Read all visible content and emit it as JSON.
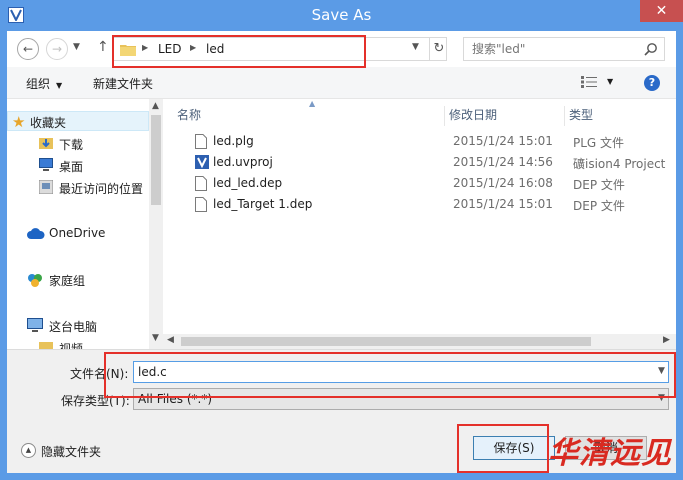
{
  "window": {
    "title": "Save As",
    "close_glyph": "✕"
  },
  "address": {
    "breadcrumbs": [
      "LED",
      "led"
    ],
    "search_placeholder": "搜索\"led\""
  },
  "toolbar": {
    "organize_label": "组织",
    "new_folder_label": "新建文件夹",
    "help_glyph": "?"
  },
  "nav": {
    "items": [
      {
        "label": "收藏夹",
        "icon": "star-icon"
      },
      {
        "label": "下载",
        "icon": "download-folder-icon"
      },
      {
        "label": "桌面",
        "icon": "desktop-icon"
      },
      {
        "label": "最近访问的位置",
        "icon": "recent-places-icon"
      },
      {
        "label": "OneDrive",
        "icon": "cloud-icon"
      },
      {
        "label": "家庭组",
        "icon": "homegroup-icon"
      },
      {
        "label": "这台电脑",
        "icon": "computer-icon"
      },
      {
        "label": "视频",
        "icon": "video-folder-icon"
      }
    ]
  },
  "list": {
    "columns": [
      "名称",
      "修改日期",
      "类型"
    ],
    "rows": [
      {
        "name": "led.plg",
        "date": "2015/1/24 15:01",
        "type": "PLG 文件",
        "icon": "file-icon"
      },
      {
        "name": "led.uvproj",
        "date": "2015/1/24 14:56",
        "type": "礦ision4 Project",
        "icon": "uvision-project-icon"
      },
      {
        "name": "led_led.dep",
        "date": "2015/1/24 16:08",
        "type": "DEP 文件",
        "icon": "file-icon"
      },
      {
        "name": "led_Target 1.dep",
        "date": "2015/1/24 15:01",
        "type": "DEP 文件",
        "icon": "file-icon"
      }
    ]
  },
  "form": {
    "filename_label": "文件名(N):",
    "filename_value": "led.c",
    "filetype_label": "保存类型(T):",
    "filetype_value": "All Files (*.*)"
  },
  "footer": {
    "hide_folders_label": "隐藏文件夹",
    "save_label": "保存(S)",
    "cancel_label": "取消"
  },
  "watermark": {
    "text": "华清远见"
  },
  "colors": {
    "title_bar": "#5b9be6",
    "highlight": "#e4302a",
    "close": "#c75050"
  }
}
